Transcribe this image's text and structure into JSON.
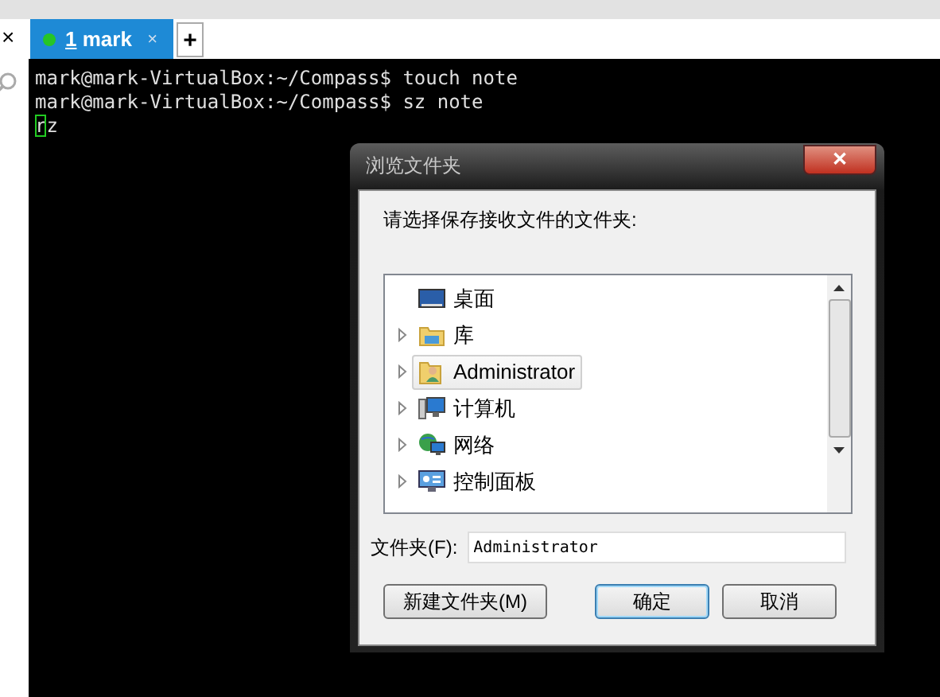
{
  "side_panel": {
    "close": "×"
  },
  "tabs": [
    {
      "number": "1",
      "label": "mark",
      "close": "×",
      "selected": true
    }
  ],
  "new_tab": "+",
  "terminal": {
    "lines": [
      {
        "text": "mark@mark-VirtualBox:~/Compass$ touch note",
        "cursor": false
      },
      {
        "text": "mark@mark-VirtualBox:~/Compass$ sz note",
        "cursor": false
      },
      {
        "text": "rz",
        "cursor": true
      }
    ]
  },
  "dialog": {
    "title": "浏览文件夹",
    "close": "✕",
    "prompt": "请选择保存接收文件的文件夹:",
    "tree": [
      {
        "kind": "desktop",
        "label": "桌面",
        "expandable": false,
        "selected": false
      },
      {
        "kind": "library",
        "label": "库",
        "expandable": true,
        "selected": false
      },
      {
        "kind": "user",
        "label": "Administrator",
        "expandable": true,
        "selected": true
      },
      {
        "kind": "computer",
        "label": "计算机",
        "expandable": true,
        "selected": false
      },
      {
        "kind": "network",
        "label": "网络",
        "expandable": true,
        "selected": false
      },
      {
        "kind": "control-panel",
        "label": "控制面板",
        "expandable": true,
        "selected": false
      }
    ],
    "folder_label": "文件夹(F):",
    "folder_value": "Administrator",
    "buttons": [
      {
        "label": "新建文件夹(M)",
        "default": false
      },
      {
        "label": "确定",
        "default": true
      },
      {
        "label": "取消",
        "default": false
      }
    ]
  }
}
